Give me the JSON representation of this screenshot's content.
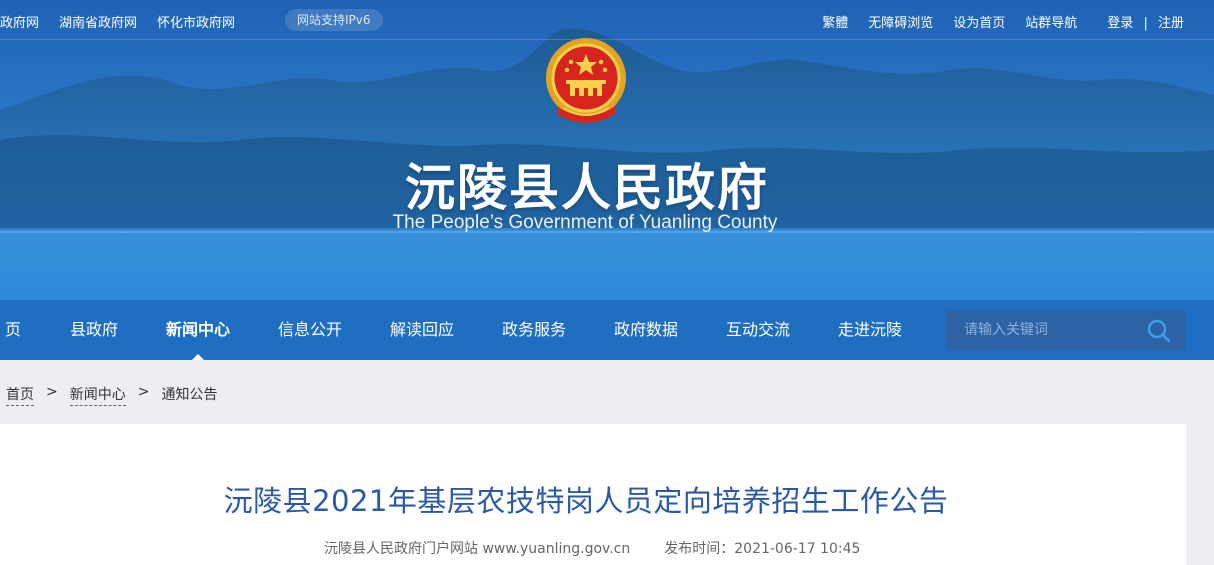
{
  "topbar": {
    "left_links": [
      "国政府网",
      "湖南省政府网",
      "怀化市政府网"
    ],
    "ipv6_badge": "网站支持IPv6",
    "right_links": [
      "繁體",
      "无障碍浏览",
      "设为首页",
      "站群导航"
    ],
    "login": "登录",
    "separator": "|",
    "register": "注册"
  },
  "header": {
    "title": "沅陵县人民政府",
    "subtitle": "The People’s Government of Yuanling County"
  },
  "nav": {
    "items": [
      "页",
      "县政府",
      "新闻中心",
      "信息公开",
      "解读回应",
      "政务服务",
      "政府数据",
      "互动交流",
      "走进沅陵"
    ],
    "active_index": 2,
    "search_placeholder": "请输入关键词"
  },
  "breadcrumb": {
    "items": [
      "首页",
      "新闻中心",
      "通知公告"
    ],
    "separator": ">"
  },
  "article": {
    "title": "沅陵县2021年基层农技特岗人员定向培养招生工作公告",
    "source": "沅陵县人民政府门户网站 www.yuanling.gov.cn",
    "publish_label": "发布时间：",
    "publish_time": "2021-06-17 10:45"
  },
  "colors": {
    "nav_bg": "#1f6ec2",
    "title_blue": "#2b5aa5",
    "page_bg": "#eceef1"
  }
}
